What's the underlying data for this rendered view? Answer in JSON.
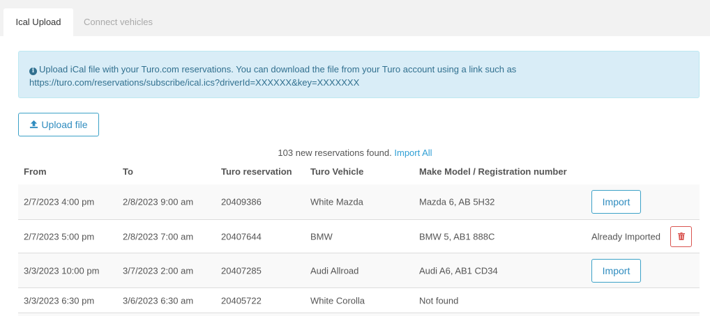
{
  "tabs": [
    {
      "label": "Ical Upload",
      "active": true
    },
    {
      "label": "Connect vehicles",
      "active": false
    }
  ],
  "alert": {
    "icon": "info-circle-icon",
    "line1": "Upload iCal file with your Turo.com reservations. You can download the file from your Turo account using a link such as",
    "line2": "https://turo.com/reservations/subscribe/ical.ics?driverId=XXXXXX&key=XXXXXXX"
  },
  "upload_button": {
    "label": "Upload file",
    "icon": "upload-icon"
  },
  "summary": {
    "text": "103 new reservations found.",
    "link": "Import All"
  },
  "table": {
    "headers": [
      "From",
      "To",
      "Turo reservation",
      "Turo Vehicle",
      "Make Model / Registration number"
    ],
    "rows": [
      {
        "from": "2/7/2023 4:00 pm",
        "to": "2/8/2023 9:00 am",
        "reservation": "20409386",
        "vehicle": "White Mazda",
        "make": "Mazda 6, AB 5H32",
        "action": "Import"
      },
      {
        "from": "2/7/2023 5:00 pm",
        "to": "2/8/2023 7:00 am",
        "reservation": "20407644",
        "vehicle": "BMW",
        "make": "BMW 5, AB1 888C",
        "status": "Already Imported"
      },
      {
        "from": "3/3/2023 10:00 pm",
        "to": "3/7/2023 2:00 am",
        "reservation": "20407285",
        "vehicle": "Audi Allroad",
        "make": "Audi A6, AB1 CD34",
        "action": "Import"
      },
      {
        "from": "3/3/2023 6:30 pm",
        "to": "3/6/2023 6:30 am",
        "reservation": "20405722",
        "vehicle": "White Corolla",
        "make": "Not found"
      }
    ]
  },
  "colors": {
    "accent": "#2f8cbf",
    "alert_bg": "#d9edf7",
    "danger": "#d9534f"
  }
}
